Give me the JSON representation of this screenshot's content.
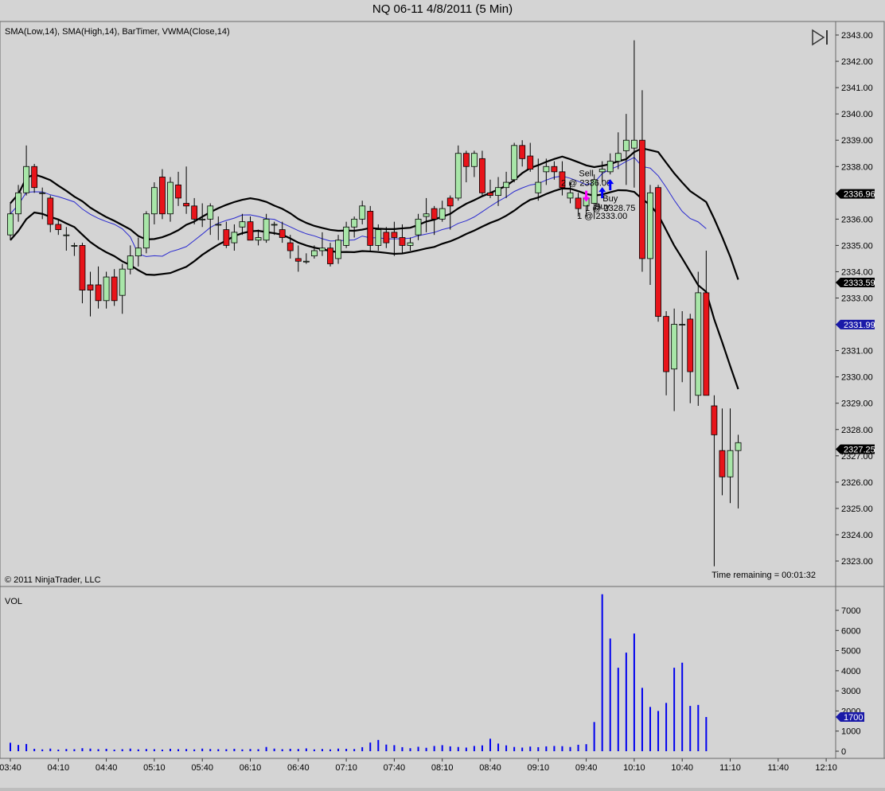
{
  "window": {
    "title": "NQ 06-11  4/8/2011 (5 Min)"
  },
  "price_panel": {
    "indicators_label": "SMA(Low,14), SMA(High,14), BarTimer, VWMA(Close,14)",
    "copyright": "© 2011 NinjaTrader, LLC",
    "timer_text": "Time remaining = 00:01:32",
    "play_icon": "skip-to-end-icon",
    "y_ticks": [
      "2343.00",
      "2342.00",
      "2341.00",
      "2340.00",
      "2339.00",
      "2338.00",
      "2337.00",
      "2336.00",
      "2335.00",
      "2334.00",
      "2333.00",
      "2332.00",
      "2331.00",
      "2330.00",
      "2329.00",
      "2328.00",
      "2327.00",
      "2326.00",
      "2325.00",
      "2324.00",
      "2323.00"
    ],
    "markers": [
      {
        "value": "2336.96",
        "color": "#000000"
      },
      {
        "value": "2333.59",
        "color": "#000000"
      },
      {
        "value": "2331.99",
        "color": "#1a1aa8"
      },
      {
        "value": "2327.25",
        "color": "#000000"
      }
    ],
    "executions": [
      {
        "action": "Sell",
        "detail": "2 @ 2336.00",
        "bar_index": 72,
        "color": "#ff00ff"
      },
      {
        "action": "Buy",
        "detail": "1 @ 2333.00",
        "bar_index": 74,
        "color": "#0000ff"
      },
      {
        "action": "Buy",
        "detail": "1 @ 2328.75",
        "bar_index": 75,
        "color": "#0000ff"
      }
    ]
  },
  "volume_panel": {
    "label": "VOL",
    "y_ticks": [
      "7000",
      "6000",
      "5000",
      "4000",
      "3000",
      "2000",
      "1000",
      "0"
    ],
    "marker": {
      "value": "1700",
      "color": "#1a1aa8"
    }
  },
  "x_axis": {
    "ticks": [
      "03:40",
      "04:10",
      "04:40",
      "05:10",
      "05:40",
      "06:10",
      "06:40",
      "07:10",
      "07:40",
      "08:10",
      "08:40",
      "09:10",
      "09:40",
      "10:10",
      "10:40",
      "11:10",
      "11:40",
      "12:10"
    ]
  },
  "colors": {
    "up_candle": "#a8e6a8",
    "down_candle": "#e8141a",
    "sma_lines": "#000000",
    "vwma_line": "#2a2ad0",
    "volume_bars": "#0000ee",
    "background": "#d4d4d4"
  },
  "chart_data": {
    "type": "candlestick",
    "title": "NQ 06-11  4/8/2011 (5 Min)",
    "x_start": "03:40",
    "bar_minutes": 5,
    "ylim": [
      2322.6,
      2343.1
    ],
    "ohlc": [
      [
        2335.4,
        2336.6,
        2335.2,
        2336.2
      ],
      [
        2336.2,
        2337.3,
        2335.9,
        2337.0
      ],
      [
        2337.0,
        2338.8,
        2336.9,
        2338.0
      ],
      [
        2338.0,
        2338.1,
        2337.0,
        2337.2
      ],
      [
        2337.0,
        2337.2,
        2336.0,
        2337.0
      ],
      [
        2336.8,
        2336.9,
        2335.5,
        2335.8
      ],
      [
        2335.8,
        2336.0,
        2335.4,
        2335.6
      ],
      [
        2335.4,
        2335.7,
        2334.8,
        2335.4
      ],
      [
        2335.0,
        2335.1,
        2334.6,
        2335.0
      ],
      [
        2335.0,
        2335.1,
        2332.8,
        2333.3
      ],
      [
        2333.5,
        2334.0,
        2332.3,
        2333.3
      ],
      [
        2333.5,
        2334.2,
        2332.6,
        2332.9
      ],
      [
        2332.9,
        2334.0,
        2332.6,
        2333.8
      ],
      [
        2333.8,
        2334.1,
        2332.7,
        2332.9
      ],
      [
        2333.1,
        2334.3,
        2332.4,
        2334.1
      ],
      [
        2334.1,
        2335.0,
        2333.9,
        2334.6
      ],
      [
        2334.6,
        2335.3,
        2334.2,
        2334.9
      ],
      [
        2334.9,
        2336.3,
        2334.7,
        2336.2
      ],
      [
        2336.2,
        2337.4,
        2335.8,
        2337.2
      ],
      [
        2337.6,
        2337.9,
        2336.0,
        2336.2
      ],
      [
        2336.2,
        2337.6,
        2335.9,
        2337.4
      ],
      [
        2337.3,
        2337.8,
        2336.5,
        2336.8
      ],
      [
        2336.6,
        2338.0,
        2336.2,
        2336.5
      ],
      [
        2336.5,
        2336.8,
        2335.8,
        2336.0
      ],
      [
        2336.0,
        2336.6,
        2335.7,
        2336.0
      ],
      [
        2336.0,
        2336.6,
        2335.4,
        2336.5
      ],
      [
        2335.8,
        2336.1,
        2335.2,
        2335.8
      ],
      [
        2335.6,
        2335.9,
        2334.9,
        2335.0
      ],
      [
        2335.1,
        2335.8,
        2334.8,
        2335.5
      ],
      [
        2335.7,
        2336.2,
        2335.4,
        2335.9
      ],
      [
        2335.9,
        2336.1,
        2335.2,
        2335.2
      ],
      [
        2335.2,
        2335.6,
        2335.0,
        2335.3
      ],
      [
        2335.2,
        2336.2,
        2335.1,
        2336.0
      ],
      [
        2335.8,
        2335.9,
        2335.4,
        2335.8
      ],
      [
        2335.6,
        2335.9,
        2335.1,
        2335.3
      ],
      [
        2335.1,
        2335.4,
        2334.5,
        2334.8
      ],
      [
        2334.5,
        2335.0,
        2334.0,
        2334.4
      ],
      [
        2334.4,
        2334.7,
        2334.3,
        2334.4
      ],
      [
        2334.6,
        2335.0,
        2334.5,
        2334.8
      ],
      [
        2334.8,
        2335.5,
        2334.6,
        2334.9
      ],
      [
        2334.9,
        2335.1,
        2334.2,
        2334.3
      ],
      [
        2334.5,
        2335.4,
        2334.3,
        2335.2
      ],
      [
        2335.0,
        2335.9,
        2334.9,
        2335.7
      ],
      [
        2335.7,
        2336.1,
        2335.3,
        2336.0
      ],
      [
        2336.0,
        2336.7,
        2335.8,
        2336.5
      ],
      [
        2336.3,
        2336.5,
        2334.8,
        2335.0
      ],
      [
        2335.0,
        2335.8,
        2334.8,
        2335.6
      ],
      [
        2335.5,
        2335.7,
        2334.9,
        2335.1
      ],
      [
        2335.5,
        2335.9,
        2334.6,
        2335.3
      ],
      [
        2335.3,
        2335.8,
        2334.7,
        2335.0
      ],
      [
        2335.0,
        2335.3,
        2334.8,
        2335.1
      ],
      [
        2335.4,
        2336.2,
        2335.2,
        2336.0
      ],
      [
        2336.1,
        2336.8,
        2335.5,
        2336.2
      ],
      [
        2336.4,
        2336.5,
        2335.4,
        2336.0
      ],
      [
        2336.0,
        2336.7,
        2335.9,
        2336.4
      ],
      [
        2336.8,
        2336.9,
        2335.6,
        2336.5
      ],
      [
        2336.8,
        2338.8,
        2336.7,
        2338.5
      ],
      [
        2338.5,
        2338.6,
        2337.4,
        2338.0
      ],
      [
        2338.0,
        2338.6,
        2337.6,
        2338.5
      ],
      [
        2338.3,
        2338.6,
        2336.9,
        2337.0
      ],
      [
        2337.0,
        2337.5,
        2336.8,
        2336.9
      ],
      [
        2336.9,
        2337.6,
        2336.5,
        2337.2
      ],
      [
        2337.2,
        2337.8,
        2336.8,
        2337.4
      ],
      [
        2337.5,
        2338.9,
        2337.4,
        2338.8
      ],
      [
        2338.8,
        2339.0,
        2338.0,
        2338.3
      ],
      [
        2338.4,
        2338.9,
        2337.8,
        2337.9
      ],
      [
        2337.0,
        2338.3,
        2336.7,
        2337.4
      ],
      [
        2337.8,
        2338.3,
        2337.3,
        2338.0
      ],
      [
        2338.0,
        2338.2,
        2337.5,
        2337.8
      ],
      [
        2337.8,
        2338.2,
        2336.9,
        2337.2
      ],
      [
        2336.8,
        2337.4,
        2336.6,
        2337.0
      ],
      [
        2336.8,
        2337.0,
        2336.1,
        2336.4
      ],
      [
        2336.5,
        2336.9,
        2336.1,
        2336.8
      ],
      [
        2336.6,
        2337.7,
        2336.0,
        2337.5
      ],
      [
        2337.8,
        2338.2,
        2337.4,
        2337.9
      ],
      [
        2337.8,
        2338.5,
        2337.7,
        2338.2
      ],
      [
        2338.2,
        2339.3,
        2337.9,
        2338.5
      ],
      [
        2338.6,
        2340.0,
        2337.3,
        2339.0
      ],
      [
        2338.7,
        2342.8,
        2337.2,
        2339.0
      ],
      [
        2339.0,
        2340.9,
        2334.0,
        2334.5
      ],
      [
        2334.5,
        2337.3,
        2333.5,
        2337.0
      ],
      [
        2337.2,
        2337.3,
        2332.1,
        2332.3
      ],
      [
        2332.3,
        2332.5,
        2329.3,
        2330.2
      ],
      [
        2330.3,
        2332.6,
        2328.7,
        2332.0
      ],
      [
        2332.0,
        2332.5,
        2329.8,
        2332.0
      ],
      [
        2332.2,
        2332.4,
        2329.0,
        2330.2
      ],
      [
        2329.3,
        2334.0,
        2328.9,
        2333.2
      ],
      [
        2333.2,
        2334.8,
        2332.5,
        2329.3
      ],
      [
        2328.9,
        2329.3,
        2322.8,
        2327.8
      ],
      [
        2327.2,
        2328.8,
        2325.5,
        2326.2
      ],
      [
        2326.2,
        2328.8,
        2325.2,
        2327.2
      ],
      [
        2327.2,
        2327.8,
        2325.0,
        2327.5
      ]
    ],
    "volume": [
      420,
      310,
      360,
      120,
      90,
      130,
      80,
      110,
      100,
      150,
      130,
      100,
      120,
      80,
      100,
      130,
      90,
      110,
      100,
      80,
      120,
      100,
      110,
      90,
      130,
      110,
      100,
      100,
      120,
      90,
      110,
      100,
      210,
      130,
      100,
      120,
      110,
      140,
      90,
      110,
      90,
      130,
      120,
      110,
      200,
      430,
      560,
      330,
      300,
      200,
      150,
      220,
      170,
      260,
      300,
      240,
      210,
      180,
      260,
      290,
      620,
      380,
      290,
      210,
      180,
      230,
      200,
      240,
      260,
      250,
      210,
      320,
      350,
      1450,
      7800,
      5600,
      4150,
      4900,
      5850,
      3150,
      2200,
      2000,
      2400,
      4150,
      4400,
      2250,
      2300,
      1700
    ],
    "volume_offset": 0,
    "volume_ylim": [
      0,
      7900
    ]
  }
}
